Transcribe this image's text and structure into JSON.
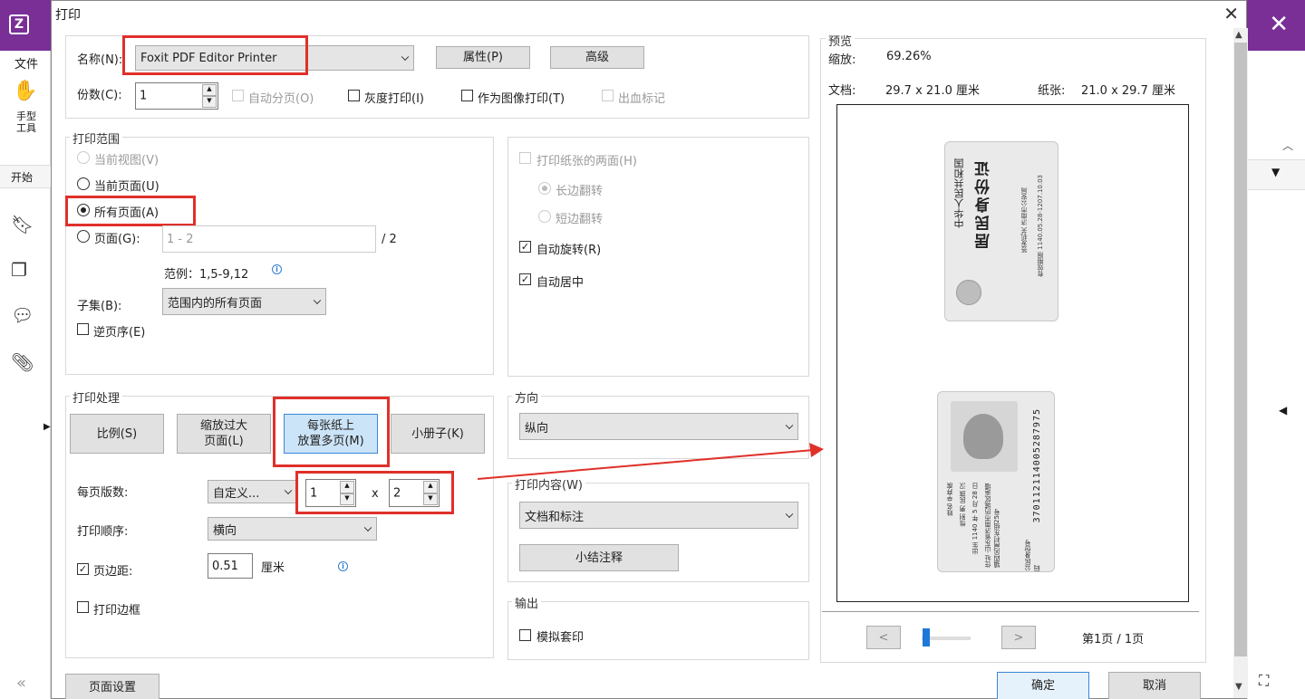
{
  "app": {
    "menu_file": "文件",
    "hand_tool": "手型\n工具",
    "start_tab": "开始"
  },
  "dialog": {
    "title": "打印",
    "printer": {
      "name_label": "名称(N):",
      "name_value": "Foxit PDF Editor Printer",
      "properties_button": "属性(P)",
      "advanced_button": "高级",
      "copies_label": "份数(C):",
      "copies_value": "1",
      "collate_label": "自动分页(O)",
      "grayscale_label": "灰度打印(I)",
      "as_image_label": "作为图像打印(T)",
      "bleed_label": "出血标记"
    },
    "range": {
      "title": "打印范围",
      "current_view": "当前视图(V)",
      "current_page": "当前页面(U)",
      "all_pages": "所有页面(A)",
      "pages_label": "页面(G):",
      "pages_value": "1 - 2",
      "total_pages": "/ 2",
      "example": "范例：1,5-9,12",
      "subset_label": "子集(B):",
      "subset_value": "范围内的所有页面",
      "reverse_label": "逆页序(E)"
    },
    "duplex": {
      "both_sides": "打印纸张的两面(H)",
      "long_edge": "长边翻转",
      "short_edge": "短边翻转",
      "auto_rotate": "自动旋转(R)",
      "auto_center": "自动居中"
    },
    "handling": {
      "title": "打印处理",
      "scale_button": "比例(S)",
      "shrink_button": "缩放过大\n页面(L)",
      "multiple_button": "每张纸上\n放置多页(M)",
      "booklet_button": "小册子(K)",
      "pages_per_sheet_label": "每页版数:",
      "pages_per_sheet_value": "自定义...",
      "cols_value": "1",
      "x_label": "x",
      "rows_value": "2",
      "order_label": "打印顺序:",
      "order_value": "横向",
      "margin_label": "页边距:",
      "margin_value": "0.51",
      "margin_unit": "厘米",
      "border_label": "打印边框"
    },
    "orientation": {
      "title": "方向",
      "value": "纵向"
    },
    "content": {
      "title": "打印内容(W)",
      "value": "文档和标注",
      "summarize_button": "小结注释"
    },
    "output": {
      "title": "输出",
      "simulate_label": "模拟套印"
    },
    "preview": {
      "title": "预览",
      "zoom_label": "缩放:",
      "zoom_value": "69.26%",
      "doc_label": "文档:",
      "doc_value": "29.7 x 21.0 厘米",
      "paper_label": "纸张:",
      "paper_value": "21.0 x 29.7 厘米",
      "prev_button": "<",
      "next_button": ">",
      "page_indicator": "第1页 / 1页",
      "card_front": {
        "line1": "中华人民共和国",
        "line2": "居民身份证",
        "issuer": "签发机关 济南市公安局",
        "valid": "有效期限 1140.05.28-1207.10.03"
      },
      "card_back": {
        "name": "姓名 辛弃疾",
        "sex": "性别 男 民族 汉",
        "birth": "出生 1140 年 5 月 28 日",
        "address": "住址 山东省济南市历城区遥墙镇四风闸村东组25号",
        "id_label": "公民身份号码",
        "id_number": "370112114005287975"
      }
    },
    "page_setup_button": "页面设置",
    "ok_button": "确定",
    "cancel_button": "取消"
  },
  "colors": {
    "brand": "#7a2f97",
    "annotation_red": "#e0302a",
    "selected_button": "#cce4f7"
  }
}
